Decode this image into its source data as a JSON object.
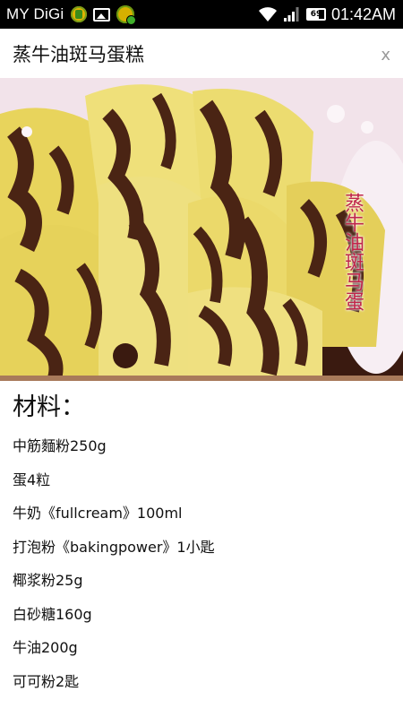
{
  "status_bar": {
    "carrier": "MY DiGi",
    "battery_level": "69",
    "time": "01:42AM",
    "icons": [
      "app-notification-icon",
      "image-icon",
      "app-update-icon",
      "wifi-icon",
      "signal-icon",
      "battery-icon"
    ]
  },
  "header": {
    "title": "蒸牛油斑马蛋糕",
    "close_label": "x"
  },
  "hero_image": {
    "alt": "蒸牛油斑马蛋糕",
    "watermark": "蒸牛油斑马蛋"
  },
  "content": {
    "section_title": "材料：",
    "ingredients": [
      "中筋麵粉250g",
      "蛋4粒",
      "牛奶《fullcream》100ml",
      "打泡粉《bakingpower》1小匙",
      "椰浆粉25g",
      "白砂糖160g",
      "牛油200g",
      "可可粉2匙"
    ]
  },
  "colors": {
    "status_bar_bg": "#000000",
    "cake_yellow": "#ecdd6c",
    "cake_brown": "#4a2414",
    "watermark_red": "#c0264a"
  }
}
